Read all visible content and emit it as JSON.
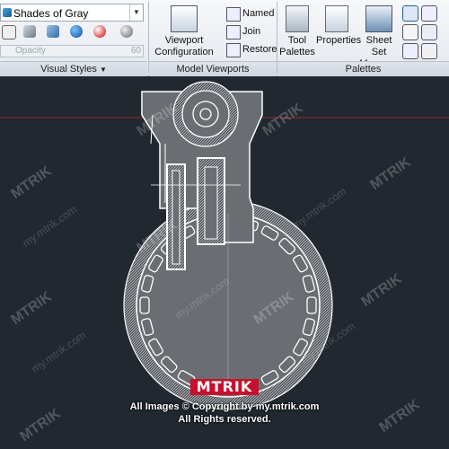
{
  "ribbon": {
    "visual_styles": {
      "combo_value": "Shades of Gray",
      "opacity_label": "Opacity",
      "opacity_value": "60",
      "panel_title": "Visual Styles"
    },
    "model_viewports": {
      "viewport_config_line1": "Viewport",
      "viewport_config_line2": "Configuration",
      "named": "Named",
      "join": "Join",
      "restore": "Restore",
      "panel_title": "Model Viewports"
    },
    "palettes": {
      "tool_palettes_line1": "Tool",
      "tool_palettes_line2": "Palettes",
      "properties": "Properties",
      "sheet_set_line1": "Sheet Set",
      "sheet_set_line2": "Manager",
      "panel_title": "Palettes"
    }
  },
  "drawing": {
    "background_color": "#212830",
    "line_color": "#ffffff",
    "fill_color": "#6a6e73"
  },
  "watermark": {
    "logo_text": "MTRIK",
    "site": "my.mtrik.com",
    "copyright_line1": "All Images © Copyright by my.mtrik.com",
    "copyright_line2": "All Rights reserved."
  }
}
